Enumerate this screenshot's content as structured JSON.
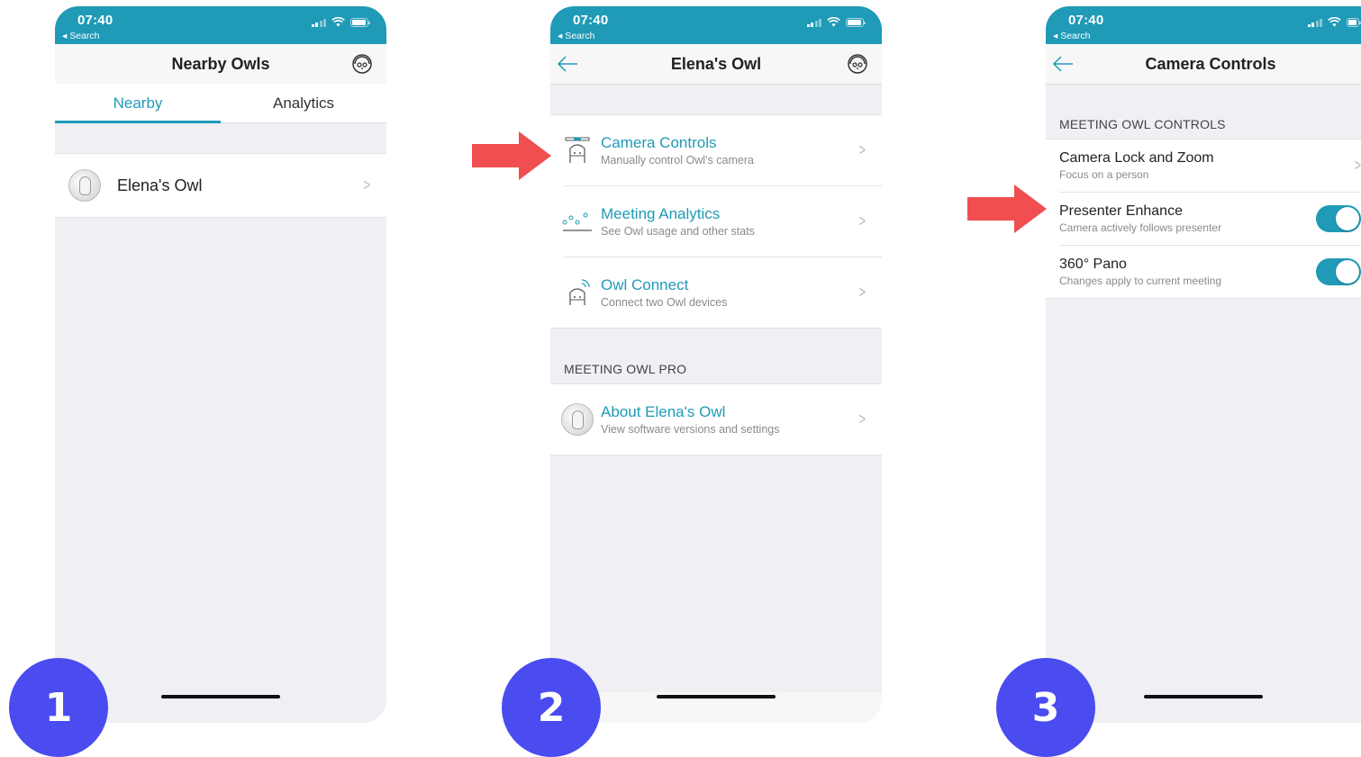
{
  "status_bar": {
    "time": "07:40",
    "back_label": "◂ Search"
  },
  "screen1": {
    "title": "Nearby Owls",
    "tabs": [
      {
        "label": "Nearby",
        "active": true
      },
      {
        "label": "Analytics",
        "active": false
      }
    ],
    "owls": [
      {
        "name": "Elena's Owl"
      }
    ]
  },
  "screen2": {
    "title": "Elena's Owl",
    "menu": [
      {
        "label": "Camera Controls",
        "sub": "Manually control Owl’s camera",
        "icon": "camera-controls-icon"
      },
      {
        "label": "Meeting Analytics",
        "sub": "See Owl usage and other stats",
        "icon": "analytics-icon"
      },
      {
        "label": "Owl Connect",
        "sub": "Connect two Owl devices",
        "icon": "owl-connect-icon"
      }
    ],
    "section": "MEETING OWL PRO",
    "about": {
      "label": "About Elena's Owl",
      "sub": "View software versions and settings"
    }
  },
  "screen3": {
    "title": "Camera Controls",
    "section": "MEETING OWL CONTROLS",
    "items": [
      {
        "label": "Camera Lock and Zoom",
        "sub": "Focus on a person",
        "type": "link"
      },
      {
        "label": "Presenter Enhance",
        "sub": "Camera actively follows presenter",
        "type": "toggle",
        "on": true
      },
      {
        "label": "360° Pano",
        "sub": "Changes apply to current meeting",
        "type": "toggle",
        "on": true
      }
    ]
  },
  "steps": [
    "1",
    "2",
    "3"
  ],
  "colors": {
    "accent": "#1f9ab7",
    "badge": "#4a4cf0",
    "arrow": "#f04e50"
  }
}
